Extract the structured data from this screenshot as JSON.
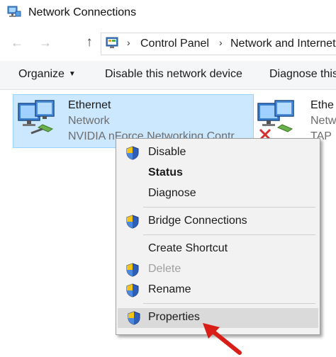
{
  "window": {
    "title": "Network Connections",
    "icon": "network-connections-icon"
  },
  "address_bar": {
    "icon": "control-panel-icon",
    "back_icon": "arrow-left-icon",
    "forward_icon": "arrow-right-icon",
    "up_icon": "arrow-up-icon",
    "crumbs": [
      "Control Panel",
      "Network and Internet"
    ]
  },
  "toolbar": {
    "organize_label": "Organize",
    "disable_label": "Disable this network device",
    "diagnose_label": "Diagnose this"
  },
  "adapters": [
    {
      "name": "Ethernet",
      "status": "Network",
      "device": "NVIDIA nForce Networking Contr",
      "selected": true
    },
    {
      "name": "Ethe",
      "status": "Netw",
      "device": "TAP",
      "disconnected": true
    }
  ],
  "context_menu": {
    "items": [
      {
        "label": "Disable",
        "shield": true
      },
      {
        "label": "Status",
        "bold": true
      },
      {
        "label": "Diagnose"
      },
      {
        "label": "Bridge Connections",
        "shield": true
      },
      {
        "label": "Create Shortcut"
      },
      {
        "label": "Delete",
        "shield": true,
        "disabled": true
      },
      {
        "label": "Rename",
        "shield": true
      },
      {
        "label": "Properties",
        "shield": true,
        "highlighted": true
      }
    ]
  },
  "colors": {
    "selection": "#cce8ff",
    "selection_border": "#99d1ff",
    "menu_bg": "#f2f2f2",
    "menu_highlight": "#dadada",
    "annotation_arrow": "#d91e18"
  }
}
